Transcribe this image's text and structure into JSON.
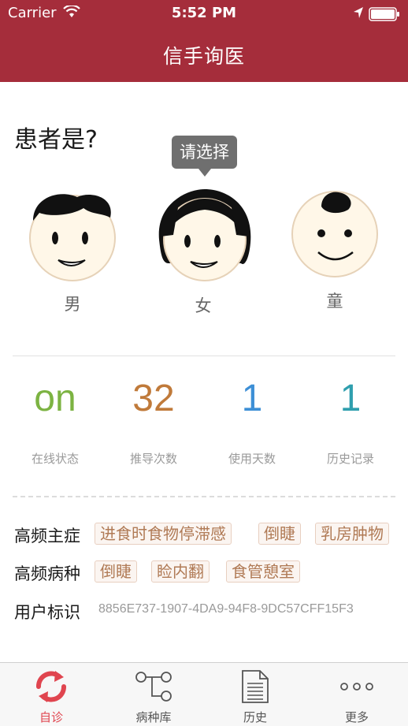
{
  "status_bar": {
    "carrier": "Carrier",
    "time": "5:52 PM"
  },
  "header": {
    "title": "信手询医"
  },
  "patient": {
    "question": "患者是?",
    "tooltip": "请选择",
    "options": [
      "男",
      "女",
      "童"
    ]
  },
  "stats": [
    {
      "value": "on",
      "label": "在线状态",
      "color": "#7cb342"
    },
    {
      "value": "32",
      "label": "推导次数",
      "color": "#c07a3a"
    },
    {
      "value": "1",
      "label": "使用天数",
      "color": "#3d8fd6"
    },
    {
      "value": "1",
      "label": "历史记录",
      "color": "#2f9fae"
    }
  ],
  "frequent_symptoms": {
    "label": "高频主症",
    "tags": [
      "进食时食物停滞感",
      "倒睫",
      "乳房肿物"
    ]
  },
  "frequent_diseases": {
    "label": "高频病种",
    "tags": [
      "倒睫",
      "睑内翻",
      "食管憩室"
    ]
  },
  "user_id": {
    "label": "用户标识",
    "value": "8856E737-1907-4DA9-94F8-9DC57CFF15F3"
  },
  "tabs": [
    {
      "label": "自诊",
      "icon": "refresh-icon",
      "active": true
    },
    {
      "label": "病种库",
      "icon": "tree-icon",
      "active": false
    },
    {
      "label": "历史",
      "icon": "document-icon",
      "active": false
    },
    {
      "label": "更多",
      "icon": "more-icon",
      "active": false
    }
  ],
  "colors": {
    "brand": "#a52d3b",
    "accent": "#e0454f"
  }
}
